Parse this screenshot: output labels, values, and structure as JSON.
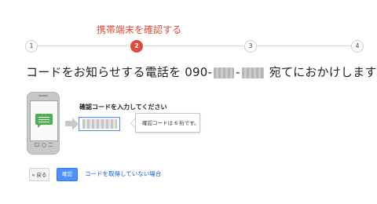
{
  "stepper": {
    "steps": [
      "1",
      "2",
      "3",
      "4"
    ],
    "active_step_label": "携帯端末を確認する",
    "colors": {
      "active": "#dd4b39",
      "line": "#d6d6d6"
    }
  },
  "heading": {
    "prefix": "コードをお知らせする電話を 090-",
    "part2": "-",
    "suffix": " 宛てにおかけします"
  },
  "phone_illustration": {
    "icon": "phone-with-message-icon",
    "message_color": "#4caf50"
  },
  "code_entry": {
    "label": "確認コードを入力してください",
    "tooltip": "確認コードは 6 桁です。"
  },
  "actions": {
    "back_label": "« 戻る",
    "next_label": "確認",
    "no_code_link": "コードを取得していない場合",
    "link_color": "#1155cc",
    "button_color": "#4d90fe"
  }
}
